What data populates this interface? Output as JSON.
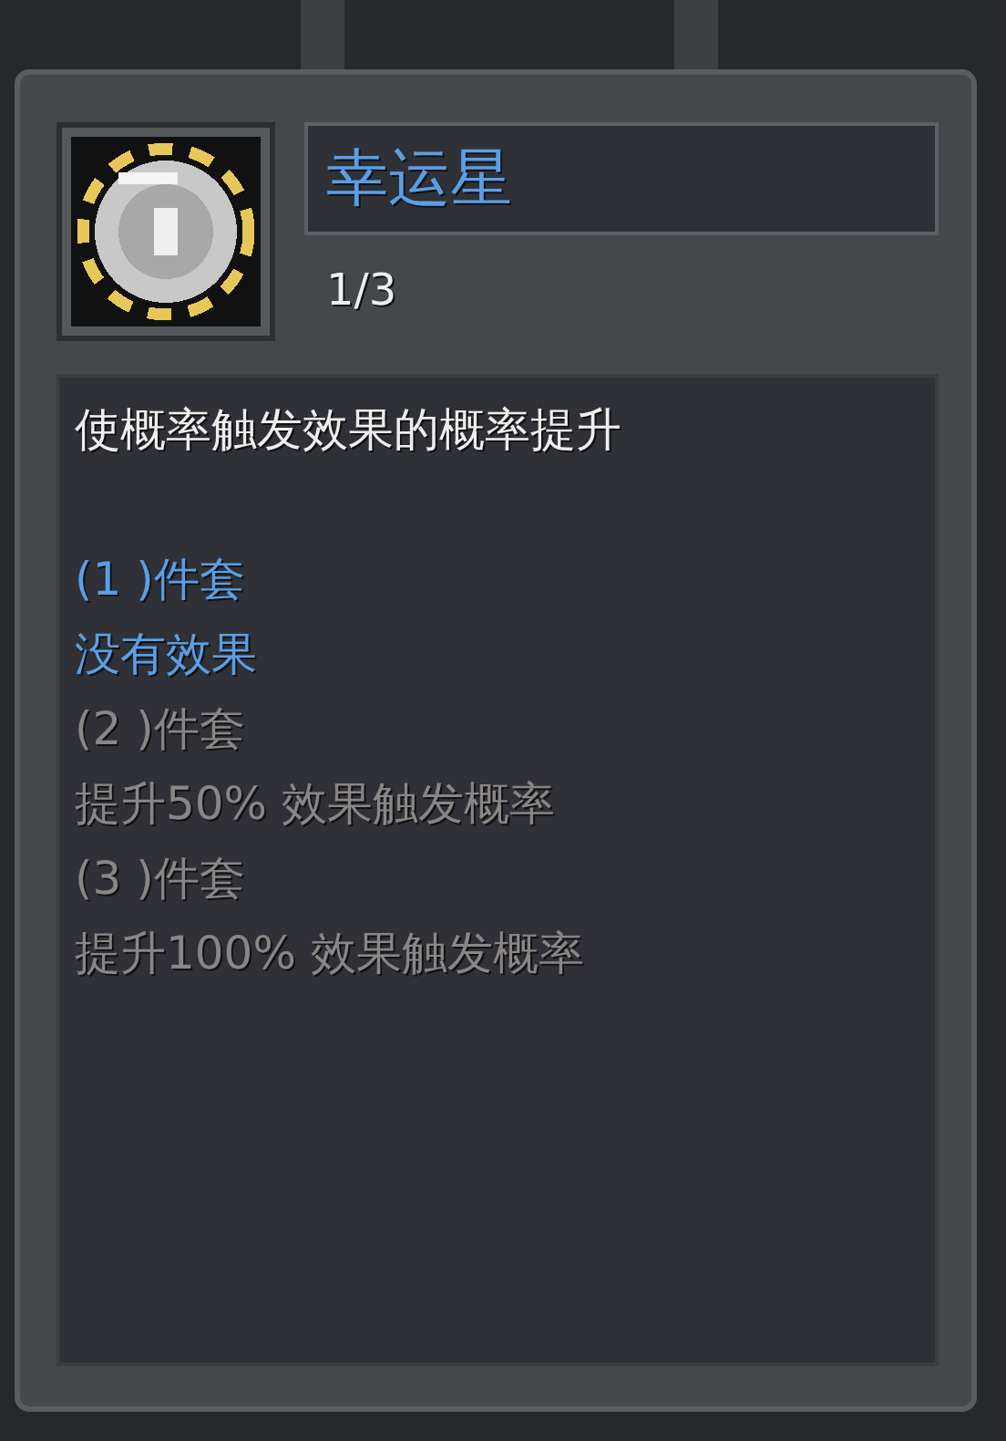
{
  "item": {
    "name": "幸运星",
    "count": "1/3",
    "description": "使概率触发效果的概率提升",
    "tiers": [
      {
        "label": "(1 )件套",
        "effect": "没有效果",
        "active": true
      },
      {
        "label": "(2 )件套",
        "effect": "提升50% 效果触发概率",
        "active": false
      },
      {
        "label": "(3 )件套",
        "effect": "提升100% 效果触发概率",
        "active": false
      }
    ]
  }
}
